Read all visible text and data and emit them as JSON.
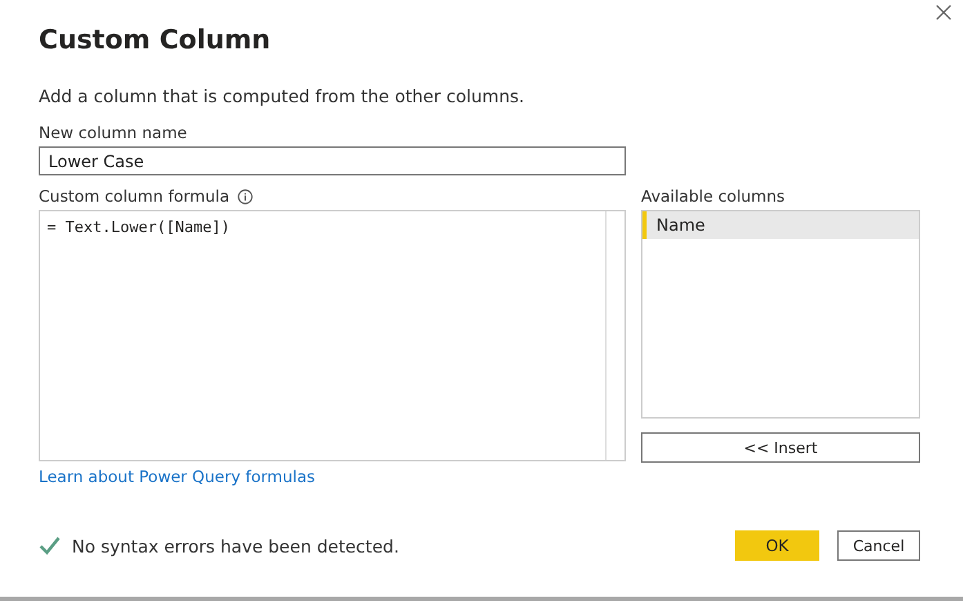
{
  "dialog": {
    "title": "Custom Column",
    "description": "Add a column that is computed from the other columns."
  },
  "name_field": {
    "label": "New column name",
    "value": "Lower Case"
  },
  "formula": {
    "label": "Custom column formula",
    "value": "= Text.Lower([Name])"
  },
  "available_columns": {
    "label": "Available columns",
    "items": [
      {
        "label": "Name",
        "selected": true
      }
    ],
    "insert_button": "<< Insert"
  },
  "link": "Learn about Power Query formulas",
  "status": {
    "ok": true,
    "text": "No syntax errors have been detected."
  },
  "buttons": {
    "ok": "OK",
    "cancel": "Cancel"
  }
}
